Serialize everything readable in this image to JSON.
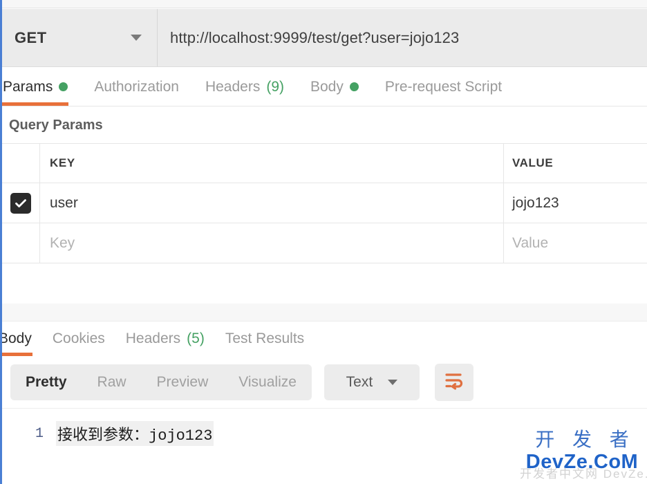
{
  "request": {
    "method": "GET",
    "method_caret_icon": "chevron-down-icon",
    "url": "http://localhost:9999/test/get?user=jojo123",
    "tabs": [
      {
        "label": "Params",
        "indicator": "dot",
        "active": true
      },
      {
        "label": "Authorization",
        "indicator": "none",
        "active": false
      },
      {
        "label": "Headers",
        "indicator": "count",
        "count": "(9)",
        "active": false
      },
      {
        "label": "Body",
        "indicator": "dot",
        "active": false
      },
      {
        "label": "Pre-request Script",
        "indicator": "none",
        "active": false
      }
    ]
  },
  "query_params": {
    "section_title": "Query Params",
    "columns": {
      "key": "KEY",
      "value": "VALUE"
    },
    "rows": [
      {
        "checked": true,
        "key": "user",
        "value": "jojo123",
        "placeholder": false
      },
      {
        "checked": false,
        "key": "Key",
        "value": "Value",
        "placeholder": true
      }
    ],
    "checkbox_icon": "check-icon"
  },
  "response": {
    "tabs": [
      {
        "label": "Body",
        "indicator": "none",
        "active": true
      },
      {
        "label": "Cookies",
        "indicator": "none",
        "active": false
      },
      {
        "label": "Headers",
        "indicator": "count",
        "count": "(5)",
        "active": false
      },
      {
        "label": "Test Results",
        "indicator": "none",
        "active": false
      }
    ],
    "format_tabs": [
      {
        "label": "Pretty",
        "active": true
      },
      {
        "label": "Raw",
        "active": false
      },
      {
        "label": "Preview",
        "active": false
      },
      {
        "label": "Visualize",
        "active": false
      }
    ],
    "content_type": "Text",
    "content_type_caret_icon": "chevron-down-icon",
    "wrap_button_icon": "word-wrap-icon",
    "body_lines": [
      {
        "number": "1",
        "text": "接收到参数：jojo123"
      }
    ]
  },
  "watermark": {
    "chinese": "开 发 者",
    "latin": "DevZe.CoM",
    "ghost": "开发者中文网 DevZe.CoM"
  },
  "colors": {
    "accent_orange": "#e8703a",
    "status_green": "#45a163",
    "toolbar_gray": "#ececec",
    "url_bar_gray": "#ebebeb",
    "watermark_blue": "#1f63c8",
    "left_border_blue": "#4a7fd4"
  }
}
